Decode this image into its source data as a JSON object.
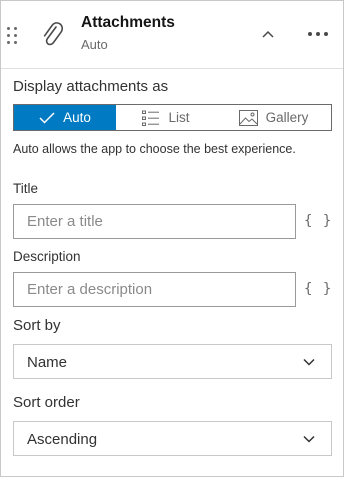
{
  "header": {
    "title": "Attachments",
    "subtitle": "Auto",
    "drag_icon": "drag-handle-icon",
    "type_icon": "paperclip-icon",
    "collapse_icon": "chevron-up-icon",
    "more_icon": "ellipsis-icon"
  },
  "display": {
    "label": "Display attachments as",
    "options": [
      {
        "label": "Auto",
        "icon": "check-icon",
        "selected": true
      },
      {
        "label": "List",
        "icon": "list-icon",
        "selected": false
      },
      {
        "label": "Gallery",
        "icon": "image-icon",
        "selected": false
      }
    ],
    "hint": "Auto allows the app to choose the best experience."
  },
  "title_field": {
    "label": "Title",
    "placeholder": "Enter a title",
    "value": "",
    "expression_label": "{ }"
  },
  "description_field": {
    "label": "Description",
    "placeholder": "Enter a description",
    "value": "",
    "expression_label": "{ }"
  },
  "sort_by": {
    "label": "Sort by",
    "value": "Name"
  },
  "sort_order": {
    "label": "Sort order",
    "value": "Ascending"
  },
  "colors": {
    "accent": "#007ac2",
    "text": "#323232",
    "border": "#c8c8c8"
  }
}
